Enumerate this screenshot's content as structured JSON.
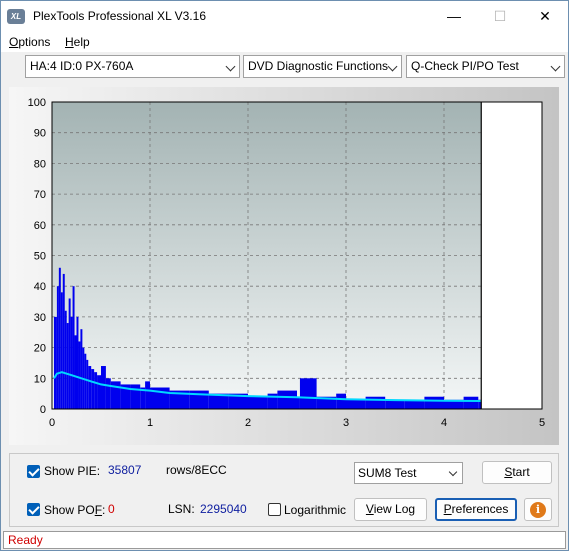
{
  "window": {
    "title": "PlexTools Professional XL V3.16",
    "icon_text": "XL",
    "min_glyph": "—",
    "max_glyph": "☐",
    "close_glyph": "✕"
  },
  "menu": {
    "options_first": "O",
    "options_rest": "ptions",
    "help_first": "H",
    "help_rest": "elp"
  },
  "toolbar": {
    "drive": "HA:4 ID:0  PX-760A",
    "function": "DVD Diagnostic Functions",
    "test": "Q-Check PI/PO Test"
  },
  "chart_data": {
    "type": "bar",
    "x_range": [
      0,
      5
    ],
    "y_range": [
      0,
      100
    ],
    "x_ticks": [
      "0",
      "1",
      "2",
      "3",
      "4",
      "5"
    ],
    "y_ticks": [
      "0",
      "10",
      "20",
      "30",
      "40",
      "50",
      "60",
      "70",
      "80",
      "90",
      "100"
    ],
    "grid": true,
    "end_marker_x": 4.38,
    "series": [
      {
        "kind": "bars",
        "color": "#0000ee",
        "points": [
          [
            0.02,
            30
          ],
          [
            0.05,
            40
          ],
          [
            0.07,
            46
          ],
          [
            0.09,
            38
          ],
          [
            0.11,
            44
          ],
          [
            0.13,
            32
          ],
          [
            0.15,
            28
          ],
          [
            0.17,
            36
          ],
          [
            0.19,
            30
          ],
          [
            0.21,
            40
          ],
          [
            0.23,
            24
          ],
          [
            0.25,
            30
          ],
          [
            0.27,
            22
          ],
          [
            0.29,
            26
          ],
          [
            0.31,
            20
          ],
          [
            0.33,
            18
          ],
          [
            0.35,
            16
          ],
          [
            0.37,
            14
          ],
          [
            0.4,
            13
          ],
          [
            0.43,
            12
          ],
          [
            0.46,
            11
          ],
          [
            0.5,
            14
          ],
          [
            0.55,
            10
          ],
          [
            0.6,
            9
          ],
          [
            0.7,
            8
          ],
          [
            0.8,
            8
          ],
          [
            0.9,
            7
          ],
          [
            0.95,
            9
          ],
          [
            1.0,
            7
          ],
          [
            1.2,
            6
          ],
          [
            1.4,
            6
          ],
          [
            1.6,
            5
          ],
          [
            1.8,
            5
          ],
          [
            2.0,
            4
          ],
          [
            2.2,
            5
          ],
          [
            2.3,
            6
          ],
          [
            2.5,
            4
          ],
          [
            2.53,
            10
          ],
          [
            2.7,
            4
          ],
          [
            2.9,
            5
          ],
          [
            3.0,
            3
          ],
          [
            3.2,
            4
          ],
          [
            3.4,
            3
          ],
          [
            3.6,
            3
          ],
          [
            3.8,
            4
          ],
          [
            4.0,
            3
          ],
          [
            4.2,
            4
          ],
          [
            4.35,
            3
          ]
        ]
      },
      {
        "kind": "line",
        "color": "#00d8ff",
        "points": [
          [
            0.02,
            10
          ],
          [
            0.05,
            11.5
          ],
          [
            0.1,
            12
          ],
          [
            0.15,
            11.5
          ],
          [
            0.2,
            11
          ],
          [
            0.3,
            10
          ],
          [
            0.4,
            9
          ],
          [
            0.5,
            8
          ],
          [
            0.6,
            7.5
          ],
          [
            0.8,
            6.5
          ],
          [
            1.0,
            6
          ],
          [
            1.2,
            5.2
          ],
          [
            1.5,
            4.8
          ],
          [
            2.0,
            4.2
          ],
          [
            2.5,
            3.8
          ],
          [
            3.0,
            3.2
          ],
          [
            3.5,
            2.9
          ],
          [
            4.0,
            2.7
          ],
          [
            4.38,
            2.6
          ]
        ]
      }
    ]
  },
  "bottom": {
    "show_pie_label": "Show PIE:",
    "pie_value": "35807",
    "rows_label": "rows/8ECC",
    "show_pof_prefix": "Show PO",
    "show_pof_ul": "F",
    "show_pof_suffix": ":",
    "pof_value": "0",
    "lsn_label": "LSN:",
    "lsn_value": "2295040",
    "log_label": "Logarithmic",
    "sum_select": "SUM8 Test",
    "start_first": "S",
    "start_rest": "tart",
    "viewlog_first": "V",
    "viewlog_rest": "iew Log",
    "prefs_first": "P",
    "prefs_rest": "references",
    "info_glyph": "i"
  },
  "status": {
    "text": "Ready"
  }
}
